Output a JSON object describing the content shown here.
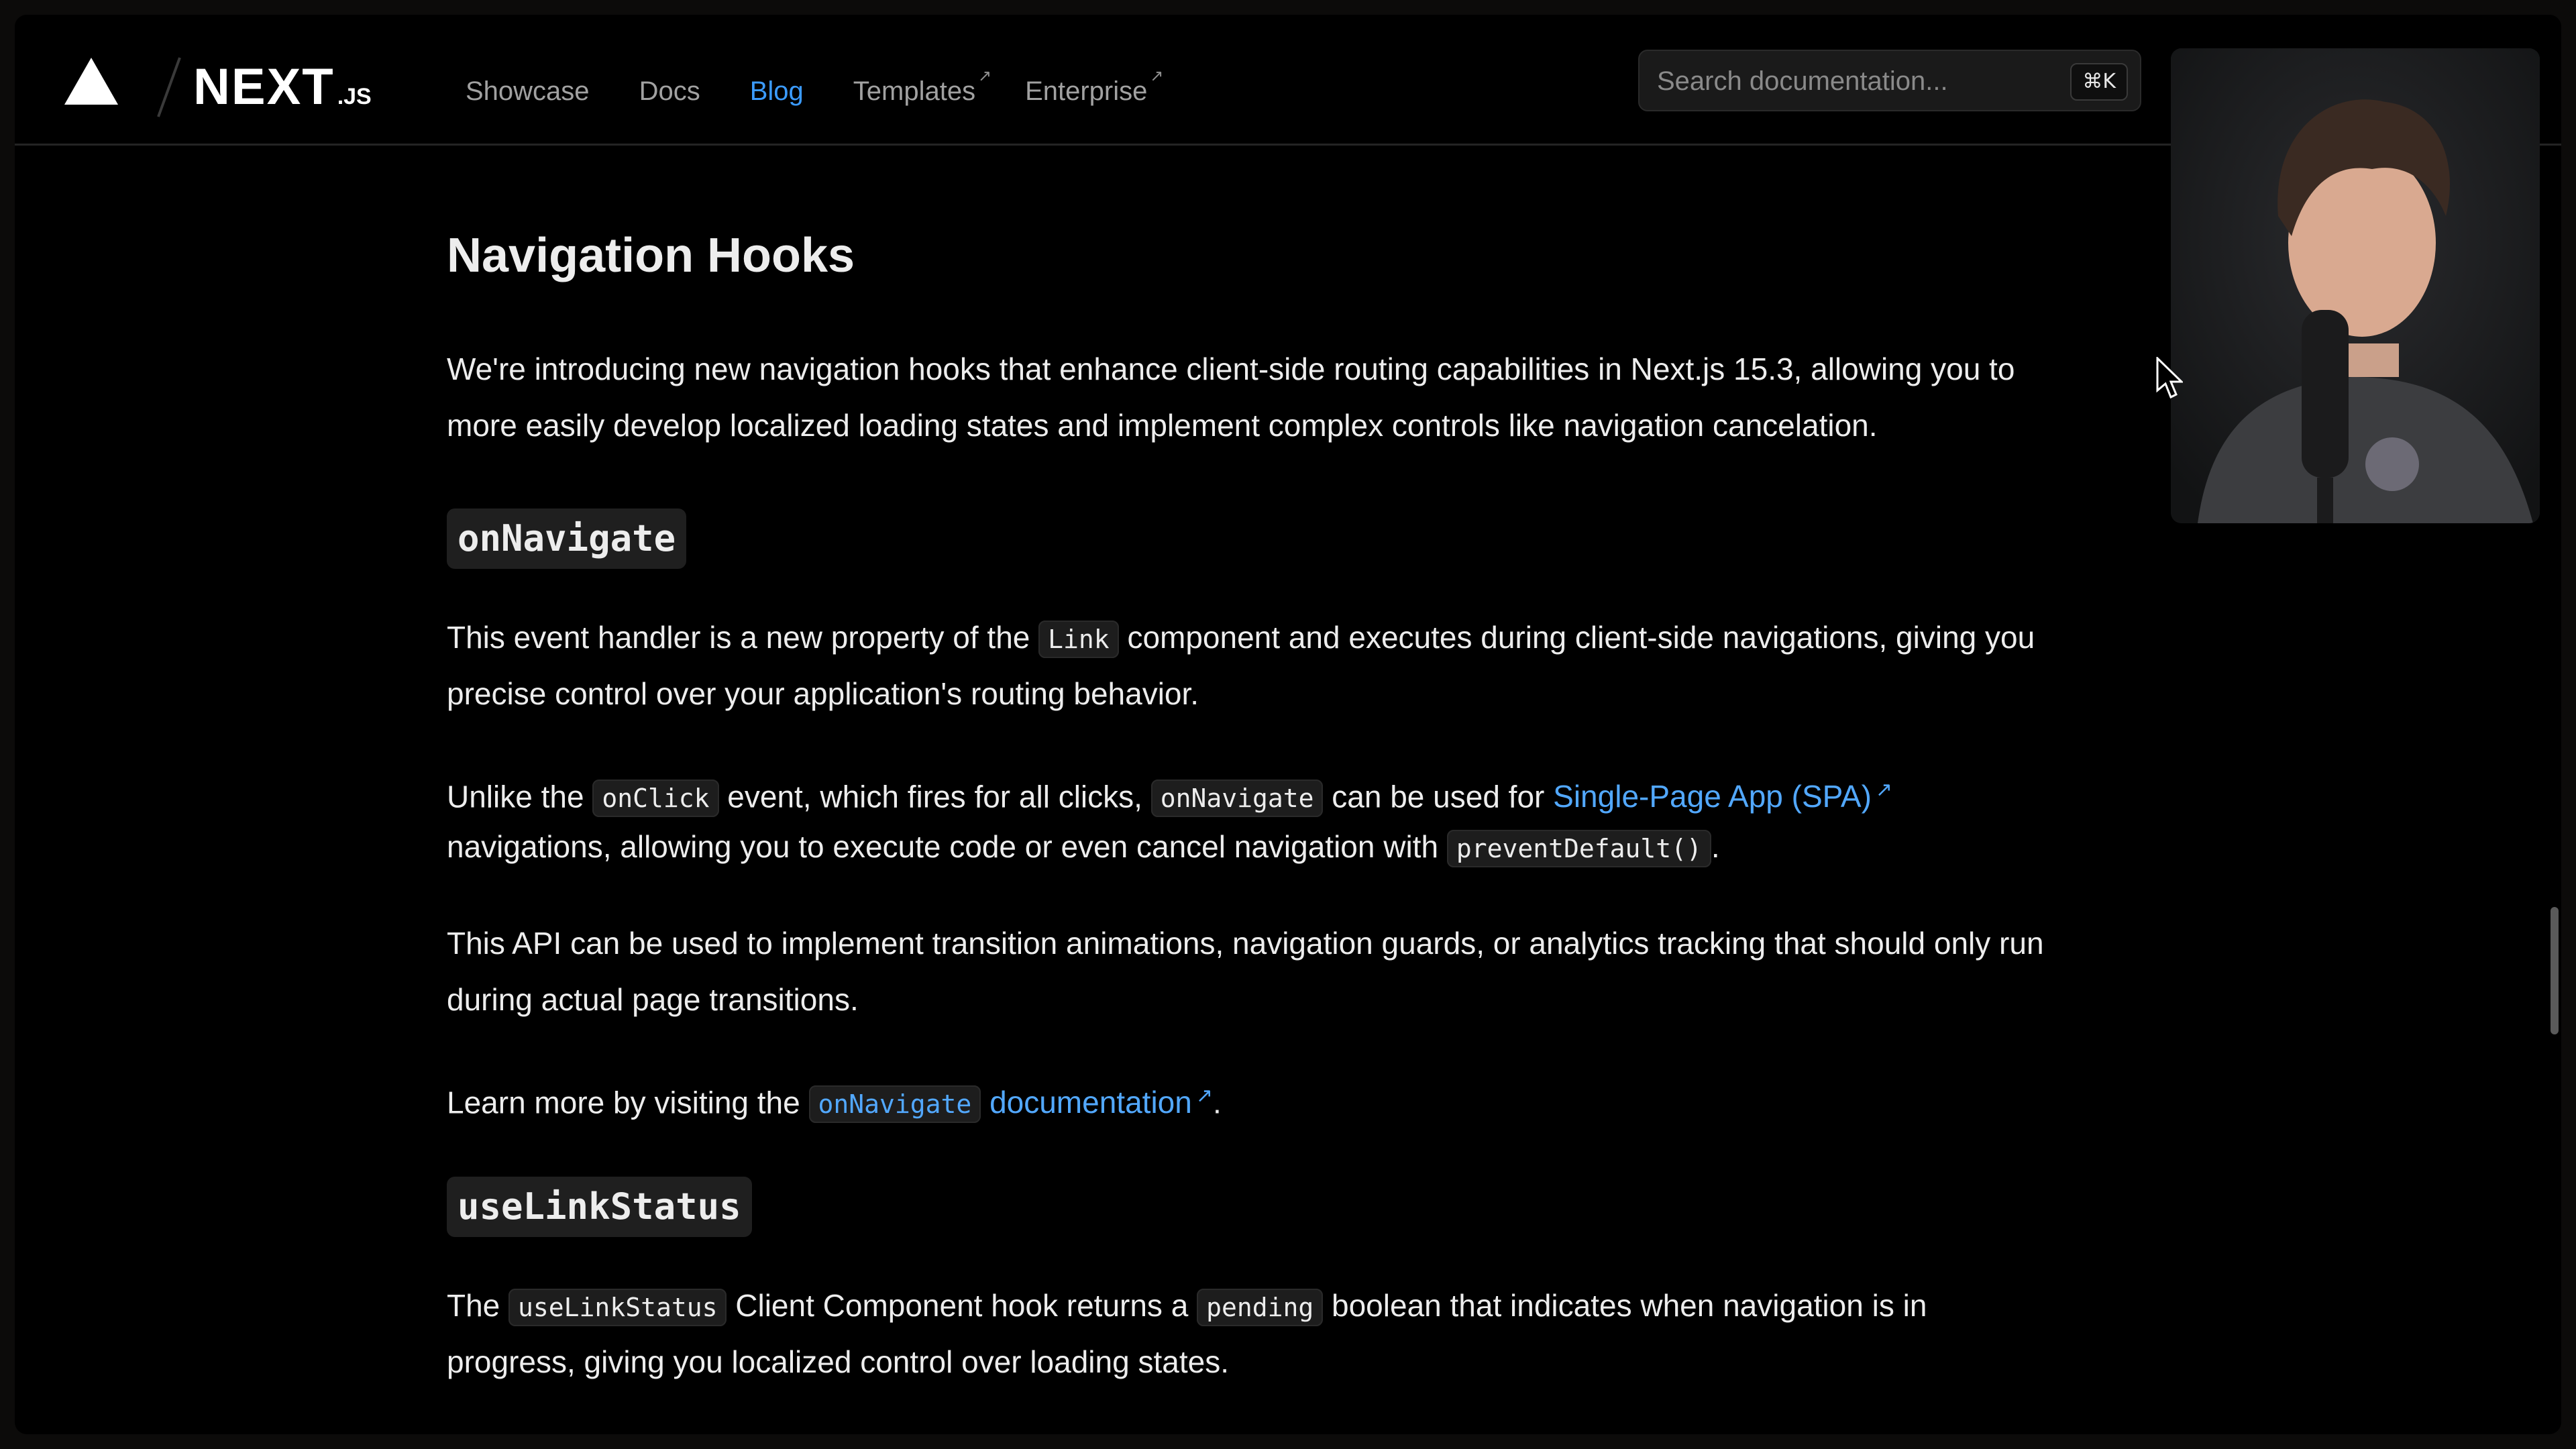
{
  "header": {
    "brand": "NEXT",
    "brand_suffix": ".JS",
    "nav": [
      {
        "label": "Showcase",
        "external": false,
        "active": false
      },
      {
        "label": "Docs",
        "external": false,
        "active": false
      },
      {
        "label": "Blog",
        "external": false,
        "active": true
      },
      {
        "label": "Templates",
        "external": true,
        "active": false
      },
      {
        "label": "Enterprise",
        "external": true,
        "active": false
      }
    ],
    "search_placeholder": "Search documentation...",
    "search_shortcut": "⌘K",
    "ext_glyph": "↗"
  },
  "article": {
    "section_title": "Navigation Hooks",
    "intro_line1": "We're introducing new navigation hooks that enhance client-side routing capabilities in Next.js 15.3, allowing you to",
    "intro_line2": "more easily develop localized loading states and implement complex controls like navigation cancelation.",
    "onnavigate": {
      "heading": "onNavigate",
      "p1_a": "This event handler is a new property of the ",
      "p1_code": "Link",
      "p1_b": " component and executes during client-side navigations, giving you",
      "p1_line2": "precise control over your application's routing behavior.",
      "p2_a": "Unlike the ",
      "p2_code1": "onClick",
      "p2_b": " event, which fires for all clicks, ",
      "p2_code2": "onNavigate",
      "p2_c": " can be used for ",
      "p2_link": "Single-Page App (SPA)",
      "p2_line2_a": "navigations, allowing you to execute code or even cancel navigation with ",
      "p2_line2_code": "preventDefault()",
      "p2_line2_b": ".",
      "p3_line1": "This API can be used to implement transition animations, navigation guards, or analytics tracking that should only run",
      "p3_line2": "during actual page transitions.",
      "p4_a": "Learn more by visiting the ",
      "p4_code": "onNavigate",
      "p4_link": "documentation",
      "p4_b": "."
    },
    "uselinkstatus": {
      "heading": "useLinkStatus",
      "p1_a": "The ",
      "p1_code1": "useLinkStatus",
      "p1_b": " Client Component hook returns a ",
      "p1_code2": "pending",
      "p1_c": " boolean that indicates when navigation is in",
      "p1_line2": "progress, giving you localized control over loading states."
    }
  },
  "colors": {
    "background": "#000000",
    "text": "#ededed",
    "muted": "#a1a1a1",
    "link": "#52a8ff",
    "active_nav": "#3b9bff"
  }
}
